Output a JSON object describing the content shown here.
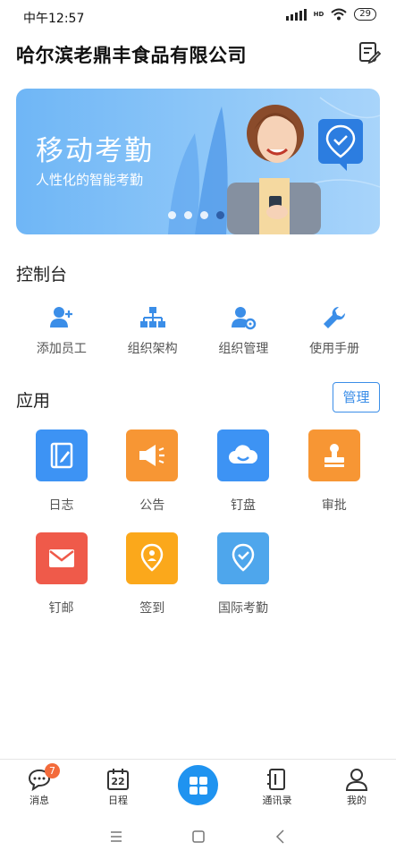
{
  "status_bar": {
    "time": "中午12:57",
    "network": "HD",
    "battery": "29"
  },
  "header": {
    "company_name": "哈尔滨老鼎丰食品有限公司",
    "edit_icon": "edit-list-icon"
  },
  "banner": {
    "title": "移动考勤",
    "subtitle": "人性化的智能考勤",
    "dots": 4,
    "active_dot_index": 3
  },
  "console": {
    "title": "控制台",
    "items": [
      {
        "label": "添加员工",
        "icon": "add-user-icon"
      },
      {
        "label": "组织架构",
        "icon": "org-chart-icon"
      },
      {
        "label": "组织管理",
        "icon": "user-settings-icon"
      },
      {
        "label": "使用手册",
        "icon": "wrench-icon"
      }
    ]
  },
  "apps": {
    "title": "应用",
    "manage_label": "管理",
    "items": [
      {
        "label": "日志",
        "icon": "notebook-icon",
        "color": "#3d93f4"
      },
      {
        "label": "公告",
        "icon": "megaphone-icon",
        "color": "#f79634"
      },
      {
        "label": "钉盘",
        "icon": "cloud-icon",
        "color": "#3d93f4"
      },
      {
        "label": "审批",
        "icon": "stamp-icon",
        "color": "#f79634"
      },
      {
        "label": "钉邮",
        "icon": "mail-icon",
        "color": "#ef5a4a"
      },
      {
        "label": "签到",
        "icon": "location-pin-icon",
        "color": "#fba81b"
      },
      {
        "label": "国际考勤",
        "icon": "check-pin-icon",
        "color": "#4ea6ec"
      }
    ]
  },
  "tab_bar": {
    "items": [
      {
        "label": "消息",
        "icon": "chat-icon",
        "badge": "7"
      },
      {
        "label": "日程",
        "icon": "calendar-icon",
        "day": "22"
      },
      {
        "label": "",
        "icon": "grid-icon"
      },
      {
        "label": "通讯录",
        "icon": "contacts-icon"
      },
      {
        "label": "我的",
        "icon": "profile-icon"
      }
    ]
  },
  "colors": {
    "accent": "#1f93f0",
    "console_icon": "#3b8ee8"
  }
}
